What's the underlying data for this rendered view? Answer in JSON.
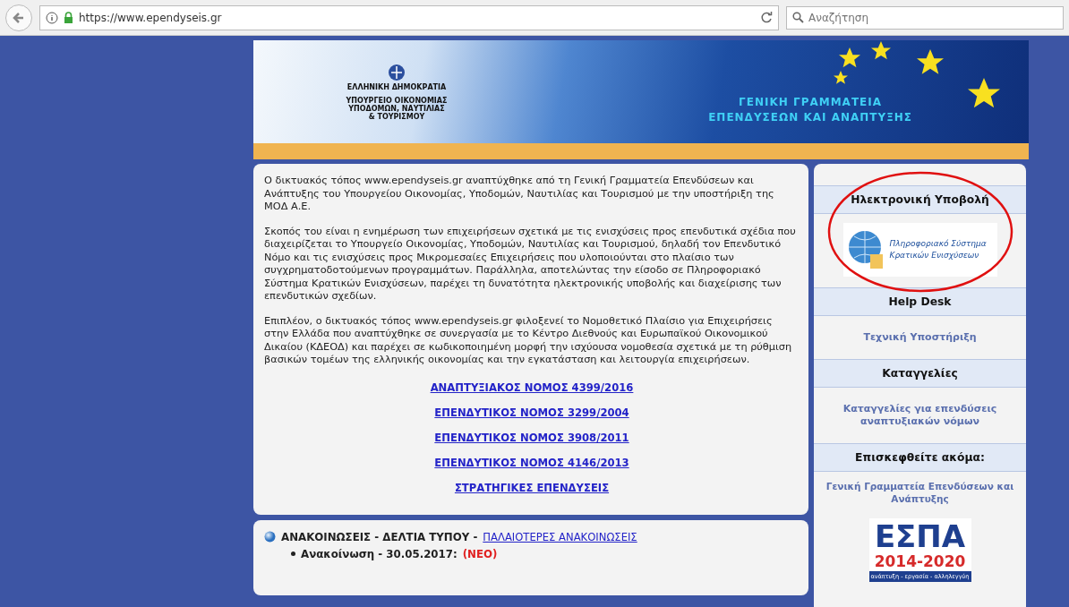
{
  "browser": {
    "url": "https://www.ependyseis.gr",
    "search_placeholder": "Αναζήτηση"
  },
  "banner": {
    "state": "ΕΛΛΗΝΙΚΗ ΔΗΜΟΚΡΑΤΙΑ",
    "ministry": [
      "ΥΠΟΥΡΓΕΙΟ ΟΙΚΟΝΟΜΙΑΣ",
      "ΥΠΟΔΟΜΩΝ, ΝΑΥΤΙΛΙΑΣ",
      "& ΤΟΥΡΙΣΜΟΥ"
    ],
    "secretariat": [
      "ΓΕΝΙΚΗ ΓΡΑΜΜΑΤΕΙΑ",
      "ΕΠΕΝΔΥΣΕΩΝ ΚΑΙ ΑΝΑΠΤΥΞΗΣ"
    ]
  },
  "intro": {
    "paragraphs": [
      "Ο δικτυακός τόπος www.ependyseis.gr αναπτύχθηκε από τη Γενική Γραμματεία Επενδύσεων και Ανάπτυξης του Υπουργείου Οικονομίας, Υποδομών, Ναυτιλίας και Τουρισμού με την υποστήριξη της ΜΟΔ Α.Ε.",
      "Σκοπός του είναι η ενημέρωση των επιχειρήσεων σχετικά με τις ενισχύσεις προς επενδυτικά σχέδια που διαχειρίζεται το Υπουργείο Οικονομίας, Υποδομών, Ναυτιλίας και Τουρισμού, δηλαδή τον Επενδυτικό Νόμο και τις ενισχύσεις προς Μικρομεσαίες Επιχειρήσεις που υλοποιούνται στο πλαίσιο των συγχρηματοδοτούμενων προγραμμάτων. Παράλληλα, αποτελώντας την είσοδο σε Πληροφοριακό Σύστημα Κρατικών Ενισχύσεων, παρέχει τη δυνατότητα ηλεκτρονικής υποβολής και διαχείρισης των επενδυτικών σχεδίων.",
      "Επιπλέον, ο δικτυακός τόπος www.ependyseis.gr φιλοξενεί το Νομοθετικό Πλαίσιο για Επιχειρήσεις στην Ελλάδα που αναπτύχθηκε σε συνεργασία με το Κέντρο Διεθνούς και Ευρωπαϊκού Οικονομικού Δικαίου (ΚΔΕΟΔ) και παρέχει σε κωδικοποιημένη μορφή την ισχύουσα νομοθεσία σχετικά με τη ρύθμιση βασικών τομέων της ελληνικής οικονομίας και την εγκατάσταση και λειτουργία επιχειρήσεων."
    ],
    "links": [
      "ΑΝΑΠΤΥΞΙΑΚΟΣ ΝΟΜΟΣ 4399/2016",
      "ΕΠΕΝΔΥΤΙΚΟΣ ΝΟΜΟΣ 3299/2004",
      "ΕΠΕΝΔΥΤΙΚΟΣ ΝΟΜΟΣ 3908/2011",
      "ΕΠΕΝΔΥΤΙΚΟΣ ΝΟΜΟΣ 4146/2013",
      "ΣΤΡΑΤΗΓΙΚΕΣ ΕΠΕΝΔΥΣΕΙΣ"
    ]
  },
  "news": {
    "title": "ΑΝΑΚΟΙΝΩΣΕΙΣ - ΔΕΛΤΙΑ ΤΥΠΟΥ -",
    "more_link": "ΠΑΛΑΙΟΤΕΡΕΣ ΑΝΑΚΟΙΝΩΣΕΙΣ",
    "items": [
      {
        "label": "Ανακοίνωση - 30.05.2017:",
        "badge": "(ΝΕΟ)"
      }
    ]
  },
  "sidebar": [
    {
      "kind": "header",
      "text": "Ηλεκτρονική Υποβολή"
    },
    {
      "kind": "system_logo",
      "lines": [
        "Πληροφοριακό Σύστημα",
        "Κρατικών Ενισχύσεων"
      ]
    },
    {
      "kind": "header",
      "text": "Help Desk"
    },
    {
      "kind": "link",
      "text": "Τεχνική Υποστήριξη"
    },
    {
      "kind": "header",
      "text": "Καταγγελίες"
    },
    {
      "kind": "link",
      "text": "Καταγγελίες για επενδύσεις αναπτυξιακών νόμων"
    },
    {
      "kind": "header",
      "text": "Επισκεφθείτε ακόμα:"
    },
    {
      "kind": "plain_link",
      "text": "Γενική Γραμματεία Επενδύσεων και Ανάπτυξης"
    },
    {
      "kind": "espa_logo",
      "lines": [
        "ΕΣΠΑ",
        "2014-2020",
        "ανάπτυξη - εργασία - αλληλεγγύη"
      ]
    }
  ]
}
